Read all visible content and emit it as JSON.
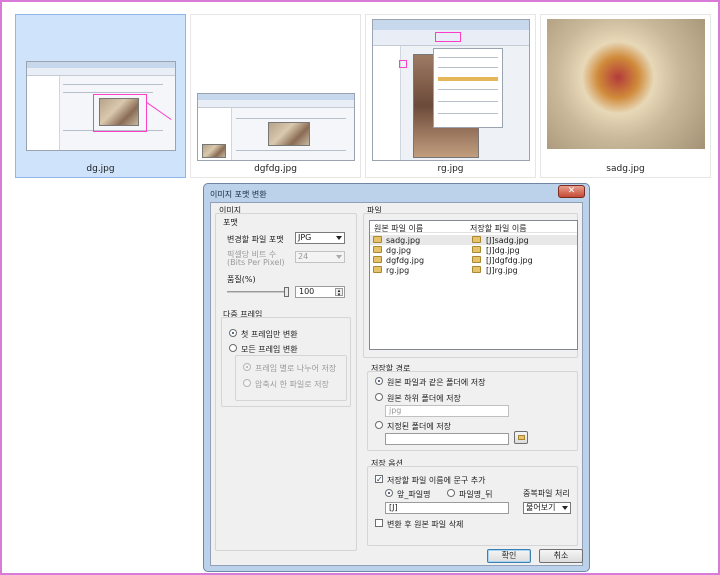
{
  "thumbnails": [
    {
      "caption": "dg.jpg"
    },
    {
      "caption": "dgfdg.jpg"
    },
    {
      "caption": "rg.jpg"
    },
    {
      "caption": "sadg.jpg"
    }
  ],
  "dialog": {
    "title": "이미지 포맷 변환",
    "close_label": "✕",
    "image_group": {
      "title": "이미지",
      "format_group_title": "포맷",
      "target_format_label": "변경할 파일 포맷",
      "target_format_value": "JPG",
      "bpp_label_1": "픽셀당 비트 수",
      "bpp_label_2": "(Bits Per Pixel)",
      "bpp_value": "24",
      "quality_label": "품질(%)",
      "quality_value": "100",
      "quality_percent": 100
    },
    "multiframe_group": {
      "title": "다중 프레임",
      "first_frame_label": "첫 프레임만 변환",
      "all_frames_label": "모든 프레임 변환",
      "split_label": "프레임 별로 나누어 저장",
      "merge_label": "압축시 한 파일로 저장"
    },
    "file_group": {
      "title": "파일",
      "col_original": "원본 파일 이름",
      "col_target": "저장할 파일 이름",
      "rows": [
        {
          "original": "sadg.jpg",
          "target": "[J]sadg.jpg"
        },
        {
          "original": "dg.jpg",
          "target": "[J]dg.jpg"
        },
        {
          "original": "dgfdg.jpg",
          "target": "[J]dgfdg.jpg"
        },
        {
          "original": "rg.jpg",
          "target": "[J]rg.jpg"
        }
      ]
    },
    "save_path_group": {
      "title": "저장할 경로",
      "same_folder_label": "원본 파일과 같은 폴더에 저장",
      "sub_folder_label": "원본 하위 폴더에 저장",
      "sub_folder_value": "jpg",
      "custom_folder_label": "지정된 폴더에 저장",
      "custom_folder_value": ""
    },
    "save_options_group": {
      "title": "저장 옵션",
      "add_text_label": "저장할 파일 이름에 문구 추가",
      "prefix_label": "앞_파일명",
      "suffix_label": "파일명_뒤",
      "text_value": "[J]",
      "duplicate_label": "중복파일 처리",
      "duplicate_value": "물어보기",
      "delete_original_label": "변환 후 원본 파일 삭제"
    },
    "ok_label": "확인",
    "cancel_label": "취소"
  },
  "colors": {
    "selection": "#cfe3fb",
    "dialog_frame": "#bcd1ea",
    "annotation_pink": "#ff3fc8",
    "close_red": "#c44a36"
  }
}
